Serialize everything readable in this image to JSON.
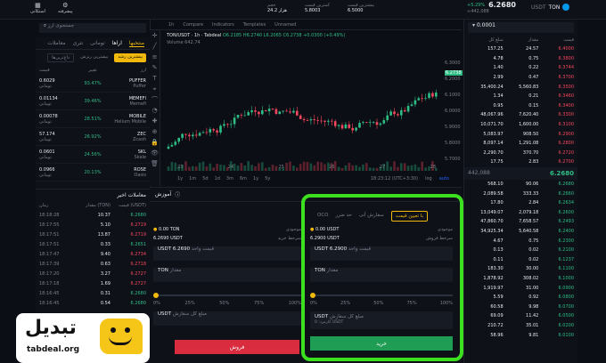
{
  "topbar": {
    "pair": "TON",
    "pair_quote": "USDT",
    "last_price": "6.2680",
    "last_price_irr": "≈442,088",
    "change_pct": "+5.29%",
    "low_label": "کمترین قیمت",
    "low_value": "5.8003",
    "high_label": "بیشترین قیمت",
    "high_value": "6.5000",
    "volume_label": "حجم",
    "volume_value": "24.2 هزار",
    "tab1": "استکانی",
    "tab2": "پیشرفته"
  },
  "left_panel": {
    "search_placeholder": "جستجوی ارز",
    "tabs": [
      "منتخبها",
      "اراها",
      "تومانی",
      "تتری",
      "معاملات"
    ],
    "filter_a": "بیشترین رشد",
    "filter_b": "بیشترین ریزش",
    "filter_c": "داغ‌ترین‌ها",
    "headers": [
      "ارز",
      "تغییر",
      "قیمت"
    ],
    "rows": [
      {
        "name": "PUFFER",
        "sub": "Puffer",
        "change": "93.47%",
        "price": "0.6029",
        "price_sub": "تومانی"
      },
      {
        "name": "MEMEFI",
        "sub": "Memefi",
        "change": "39.46%",
        "price": "0.01134",
        "price_sub": "تومانی"
      },
      {
        "name": "MOBILE",
        "sub": "Helium Mobile",
        "change": "28.51%",
        "price": "0.00078",
        "price_sub": "تومانی"
      },
      {
        "name": "ZEC",
        "sub": "Zcash",
        "change": "26.92%",
        "price": "57.174",
        "price_sub": "تومانی"
      },
      {
        "name": "SKL",
        "sub": "Skale",
        "change": "24.56%",
        "price": "0.0601",
        "price_sub": "تومانی"
      },
      {
        "name": "ROSE",
        "sub": "Oasis",
        "change": "20.13%",
        "price": "0.0966",
        "price_sub": "تومانی"
      }
    ]
  },
  "chart": {
    "toolbar": [
      "1h",
      "Compare",
      "Indicators",
      "Templates",
      "Unnamed"
    ],
    "symbol_line": "TON/USDT · 1h · Tabdeal",
    "ohlc": "O6.2185 H6.2740 L6.2065 C6.2738 +0.0300 (+0.49%)",
    "volume": "Volume 642.74",
    "price_tag": "6.2738",
    "y_ticks": [
      "6.3000",
      "6.2738",
      "6.2000",
      "6.1000",
      "6.0000",
      "5.9000",
      "5.8000",
      "5.7000"
    ],
    "x_ticks": [
      "23",
      "24",
      "25",
      "26",
      "27",
      "28"
    ],
    "ranges": [
      "1y",
      "1m",
      "5d",
      "1d",
      "3m",
      "6m",
      "1y",
      "5y"
    ],
    "time": "18:23:12 (UTC+3:30)",
    "log": "log",
    "auto": "auto"
  },
  "orderbook": {
    "headers": [
      "قیمت",
      "مقدار",
      "مبلغ کل"
    ],
    "top_pair": "TON",
    "top_quote": "USDT",
    "price_input": "0.0001",
    "asks": [
      [
        "6.4000",
        "24.57",
        "157.25"
      ],
      [
        "6.3800",
        "0.75",
        "4.78"
      ],
      [
        "6.3744",
        "0.22",
        "1.40"
      ],
      [
        "6.3700",
        "0.47",
        "2.99"
      ],
      [
        "6.3500",
        "5,560.83",
        "35,400.24"
      ],
      [
        "6.3460",
        "0.21",
        "1.34"
      ],
      [
        "6.3400",
        "0.15",
        "0.95"
      ],
      [
        "6.3300",
        "7,620.40",
        "48,067.96"
      ],
      [
        "6.3100",
        "1,600.00",
        "10,071.70"
      ],
      [
        "6.2900",
        "908.50",
        "5,083.97"
      ],
      [
        "6.2800",
        "1,291.08",
        "8,097.14"
      ],
      [
        "6.2720",
        "370.70",
        "2,290.70"
      ],
      [
        "6.2700",
        "2.83",
        "17.75"
      ]
    ],
    "mid_price": "6.2680",
    "mid_irr": "442,088",
    "bids": [
      [
        "6.2680",
        "90.06",
        "568.10"
      ],
      [
        "6.2660",
        "333.33",
        "2,089.58"
      ],
      [
        "6.2634",
        "2.84",
        "17.80"
      ],
      [
        "6.2600",
        "2,079.18",
        "13,049.07"
      ],
      [
        "6.2493",
        "7,658.57",
        "47,860.70"
      ],
      [
        "6.2400",
        "5,640.58",
        "34,925.34"
      ],
      [
        "6.2300",
        "0.75",
        "4.67"
      ],
      [
        "6.2100",
        "0.02",
        "0.13"
      ],
      [
        "6.1237",
        "0.02",
        "0.11"
      ],
      [
        "6.1100",
        "30.00",
        "183.30"
      ],
      [
        "6.1000",
        "308.02",
        "1,878.92"
      ],
      [
        "6.0900",
        "31.00",
        "1,919.97"
      ],
      [
        "6.0800",
        "0.92",
        "5.59"
      ],
      [
        "6.0700",
        "9.98",
        "60.58"
      ],
      [
        "6.0500",
        "11.42",
        "69.09"
      ],
      [
        "6.0200",
        "35.01",
        "210.72"
      ],
      [
        "6.0100",
        "9.81",
        "58.96"
      ]
    ]
  },
  "trades": {
    "title": "معاملات اخیر",
    "headers": [
      "قیمت (USDT)",
      "مقدار (TON)",
      "زمان"
    ],
    "rows": [
      {
        "price": "6.2680",
        "amount": "10.37",
        "time": "18:18:28",
        "side": "buy"
      },
      {
        "price": "6.2719",
        "amount": "5.10",
        "time": "18:17:55",
        "side": "sell"
      },
      {
        "price": "6.2719",
        "amount": "13.87",
        "time": "18:17:51",
        "side": "sell"
      },
      {
        "price": "6.2651",
        "amount": "0.33",
        "time": "18:17:51",
        "side": "buy"
      },
      {
        "price": "6.2734",
        "amount": "9.40",
        "time": "18:17:47",
        "side": "sell"
      },
      {
        "price": "6.2718",
        "amount": "0.63",
        "time": "18:17:39",
        "side": "sell"
      },
      {
        "price": "6.2727",
        "amount": "3.27",
        "time": "18:17:20",
        "side": "sell"
      },
      {
        "price": "6.2727",
        "amount": "1.69",
        "time": "18:17:18",
        "side": "sell"
      },
      {
        "price": "6.2680",
        "amount": "0.31",
        "time": "18:16:45",
        "side": "buy"
      },
      {
        "price": "6.2680",
        "amount": "0.54",
        "time": "18:16:45",
        "side": "buy"
      }
    ]
  },
  "order": {
    "section_title": "آموزش",
    "order_types": [
      "با تعیین قیمت",
      "سفارش آنی",
      "حد ضرر",
      "OCO"
    ],
    "buy": {
      "balance_label": "موجودی",
      "balance": "0.00 USDT",
      "best_label": "سرخط فروش",
      "best": "6.2900 USDT",
      "unit_label": "قیمت واحد",
      "unit_value": "6.2900",
      "unit_quote": "USDT",
      "amount_label": "مقدار",
      "amount_unit": "TON",
      "percents": [
        "0%",
        "25%",
        "50%",
        "75%",
        "100%"
      ],
      "total_label": "مبلغ کل سفارش",
      "total_unit": "USDT",
      "fee": "کارمزد: 0 USDT",
      "button": "خرید"
    },
    "sell": {
      "balance_label": "موجودی",
      "balance": "0.00 TON",
      "best_label": "سرخط خرید",
      "best": "6.2690 USDT",
      "unit_label": "قیمت واحد",
      "unit_value": "6.2690",
      "unit_quote": "USDT",
      "amount_label": "مقدار",
      "amount_unit": "TON",
      "percents": [
        "0%",
        "25%",
        "50%",
        "75%",
        "100%"
      ],
      "total_label": "مبلغ کل سفارش",
      "total_unit": "USDT",
      "button": "فروش"
    }
  },
  "logo": {
    "name": "تبدیل",
    "url": "tabdeal.org"
  },
  "colors": {
    "buy": "#2ebd85",
    "sell": "#f6465d",
    "accent": "#f0b90b",
    "highlight_box": "#3ce01e"
  }
}
